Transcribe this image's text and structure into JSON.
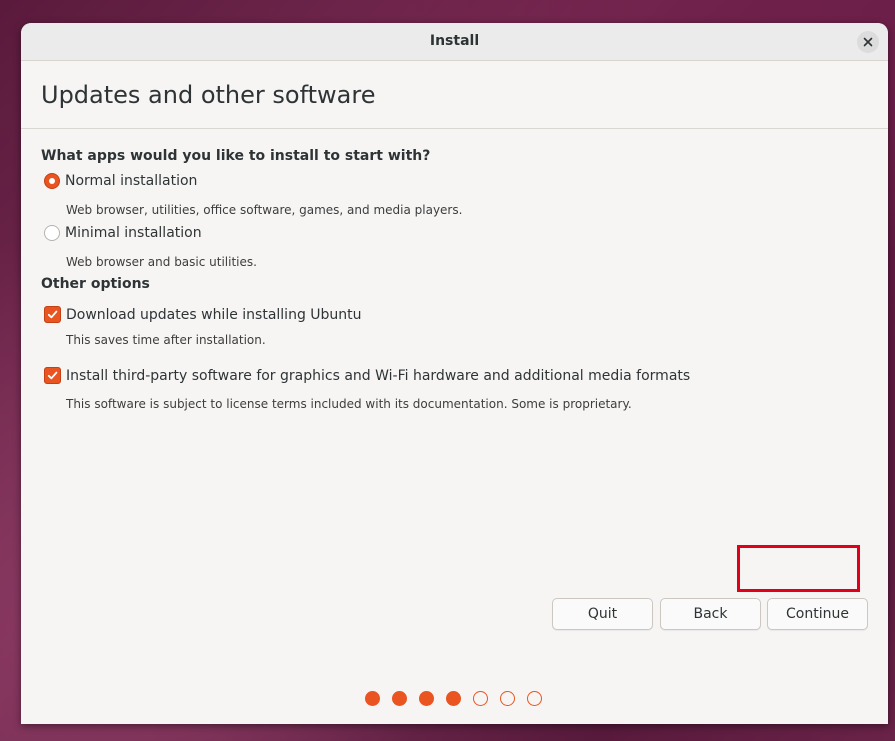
{
  "window": {
    "title": "Install"
  },
  "header": {
    "page_title": "Updates and other software"
  },
  "install_type": {
    "heading": "What apps would you like to install to start with?",
    "options": [
      {
        "label": "Normal installation",
        "description": "Web browser, utilities, office software, games, and media players.",
        "selected": true
      },
      {
        "label": "Minimal installation",
        "description": "Web browser and basic utilities.",
        "selected": false
      }
    ]
  },
  "other_options": {
    "heading": "Other options",
    "options": [
      {
        "label": "Download updates while installing Ubuntu",
        "description": "This saves time after installation.",
        "checked": true
      },
      {
        "label": "Install third-party software for graphics and Wi-Fi hardware and additional media formats",
        "description": "This software is subject to license terms included with its documentation. Some is proprietary.",
        "checked": true
      }
    ]
  },
  "buttons": {
    "quit": "Quit",
    "back": "Back",
    "continue": "Continue"
  },
  "progress": {
    "current_step": 4,
    "total_steps": 7
  },
  "colors": {
    "accent": "#e95420",
    "highlight": "#e0001a",
    "window_bg": "#f6f5f4"
  },
  "icons": {
    "close": "close-icon",
    "radio_selected": "radio-selected-icon",
    "checkbox_checked": "checkmark-icon"
  }
}
